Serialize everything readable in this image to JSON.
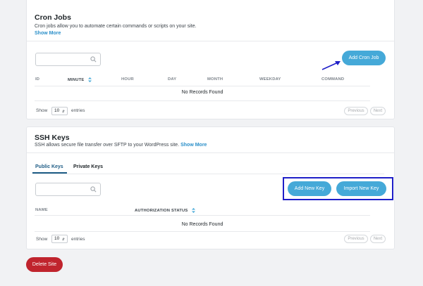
{
  "cron": {
    "title": "Cron Jobs",
    "description": "Cron jobs allow you to automate certain commands or scripts on your site.",
    "show_more": "Show More",
    "add_button": "Add Cron Job",
    "columns": [
      "ID",
      "MINUTE",
      "HOUR",
      "DAY",
      "MONTH",
      "WEEKDAY",
      "COMMAND"
    ],
    "empty_text": "No Records Found",
    "show_label": "Show",
    "page_size": "10",
    "entries_label": "entries",
    "previous": "Previous",
    "next": "Next"
  },
  "ssh": {
    "title": "SSH Keys",
    "description": "SSH allows secure file transfer over SFTP to your WordPress site.",
    "show_more": "Show More",
    "tabs": [
      "Public Keys",
      "Private Keys"
    ],
    "add_button": "Add New Key",
    "import_button": "Import New Key",
    "columns": [
      "NAME",
      "AUTHORIZATION STATUS"
    ],
    "empty_text": "No Records Found",
    "show_label": "Show",
    "page_size": "10",
    "entries_label": "entries",
    "previous": "Previous",
    "next": "Next"
  },
  "delete_button": "Delete Site",
  "icons": {
    "search": "search-icon",
    "sort": "sort-icon",
    "caret": "chevron-updown-icon",
    "arrow": "pointer-arrow-icon"
  },
  "colors": {
    "accent": "#45a9d8",
    "link": "#2a8fc9",
    "danger": "#c0242d",
    "highlight": "#1f1fc8"
  }
}
